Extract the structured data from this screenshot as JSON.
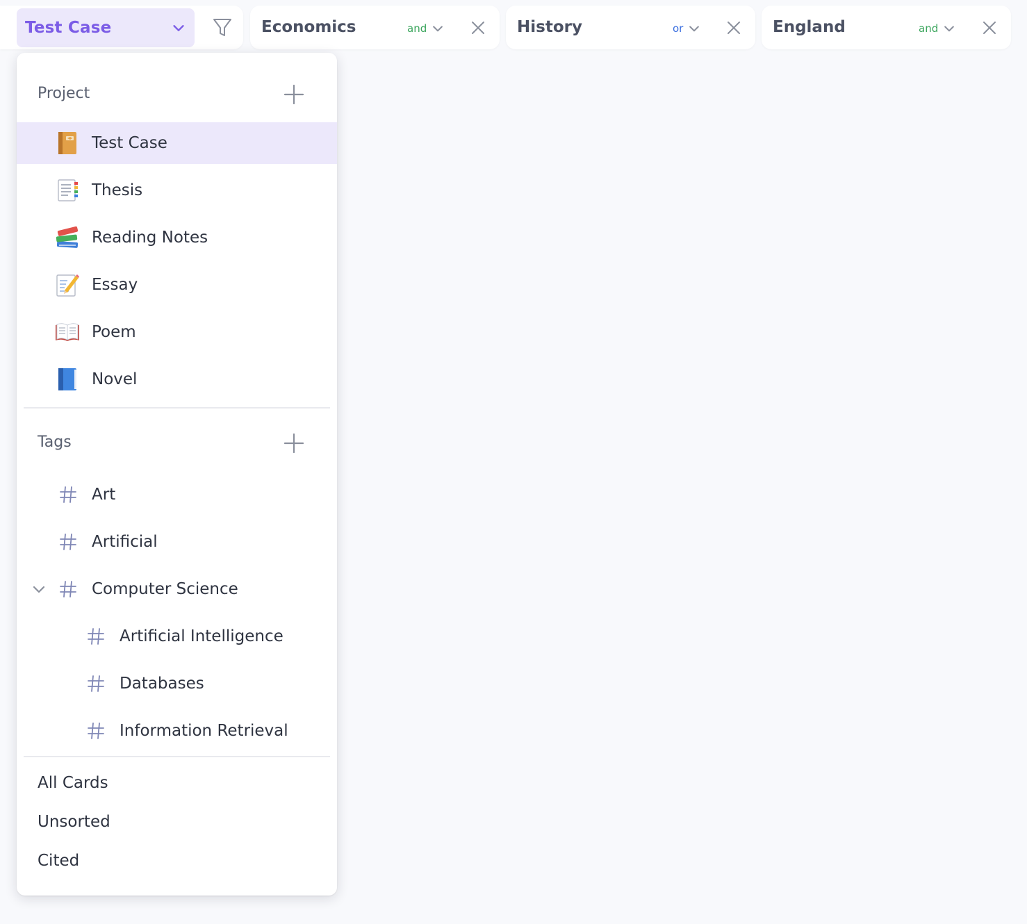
{
  "colors": {
    "accent": "#7b5ce6",
    "accent_bg": "#ece8fb",
    "and": "#3aa55c",
    "or": "#3b6fe0",
    "icon_gray": "#8a8f9c",
    "hash": "#7f86b5"
  },
  "project_select": {
    "label": "Test Case",
    "icon": "chevron-down-icon"
  },
  "filter_button": {
    "icon": "filter-icon"
  },
  "filter_chips": [
    {
      "name": "Economics",
      "operator": "and"
    },
    {
      "name": "History",
      "operator": "or"
    },
    {
      "name": "England",
      "operator": "and"
    }
  ],
  "panel": {
    "project_section": {
      "title": "Project",
      "add_icon": "plus-icon",
      "items": [
        {
          "label": "Test Case",
          "icon": "ledger-icon",
          "selected": true
        },
        {
          "label": "Thesis",
          "icon": "bookmark-tabs-icon",
          "selected": false
        },
        {
          "label": "Reading Notes",
          "icon": "books-icon",
          "selected": false
        },
        {
          "label": "Essay",
          "icon": "memo-icon",
          "selected": false
        },
        {
          "label": "Poem",
          "icon": "open-book-icon",
          "selected": false
        },
        {
          "label": "Novel",
          "icon": "blue-book-icon",
          "selected": false
        }
      ]
    },
    "tags_section": {
      "title": "Tags",
      "add_icon": "plus-icon",
      "items": [
        {
          "label": "Art",
          "level": 0
        },
        {
          "label": "Artificial",
          "level": 0
        },
        {
          "label": "Computer Science",
          "level": 0,
          "expanded": true
        },
        {
          "label": "Artificial Intelligence",
          "level": 1
        },
        {
          "label": "Databases",
          "level": 1
        },
        {
          "label": "Information Retrieval",
          "level": 1
        }
      ]
    },
    "links": [
      "All Cards",
      "Unsorted",
      "Cited"
    ]
  }
}
